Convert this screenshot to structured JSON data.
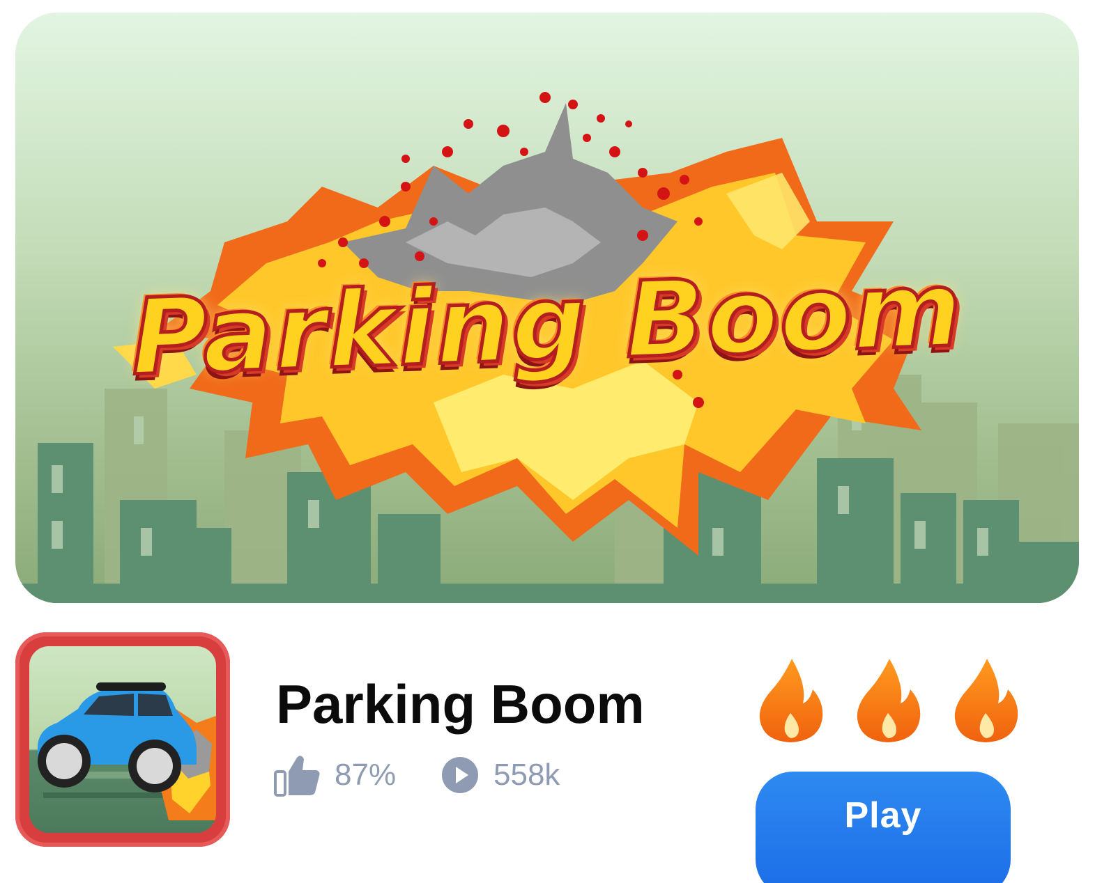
{
  "banner": {
    "logo_text": "Parking Boom"
  },
  "game": {
    "title": "Parking Boom",
    "like_rate": "87%",
    "plays": "558k",
    "flame_count": 3
  },
  "actions": {
    "play_label": "Play"
  },
  "colors": {
    "play_button": "#1f6fe8",
    "stat_text": "#8e9bb2",
    "title_text": "#0b0b0b",
    "icon_frame": "#d93e3e",
    "flame_outer": "#f47a12",
    "flame_inner": "#ffd24a"
  },
  "icons": {
    "likes": "thumbs-up-icon",
    "plays": "play-circle-icon",
    "rating": "flame-icon"
  }
}
